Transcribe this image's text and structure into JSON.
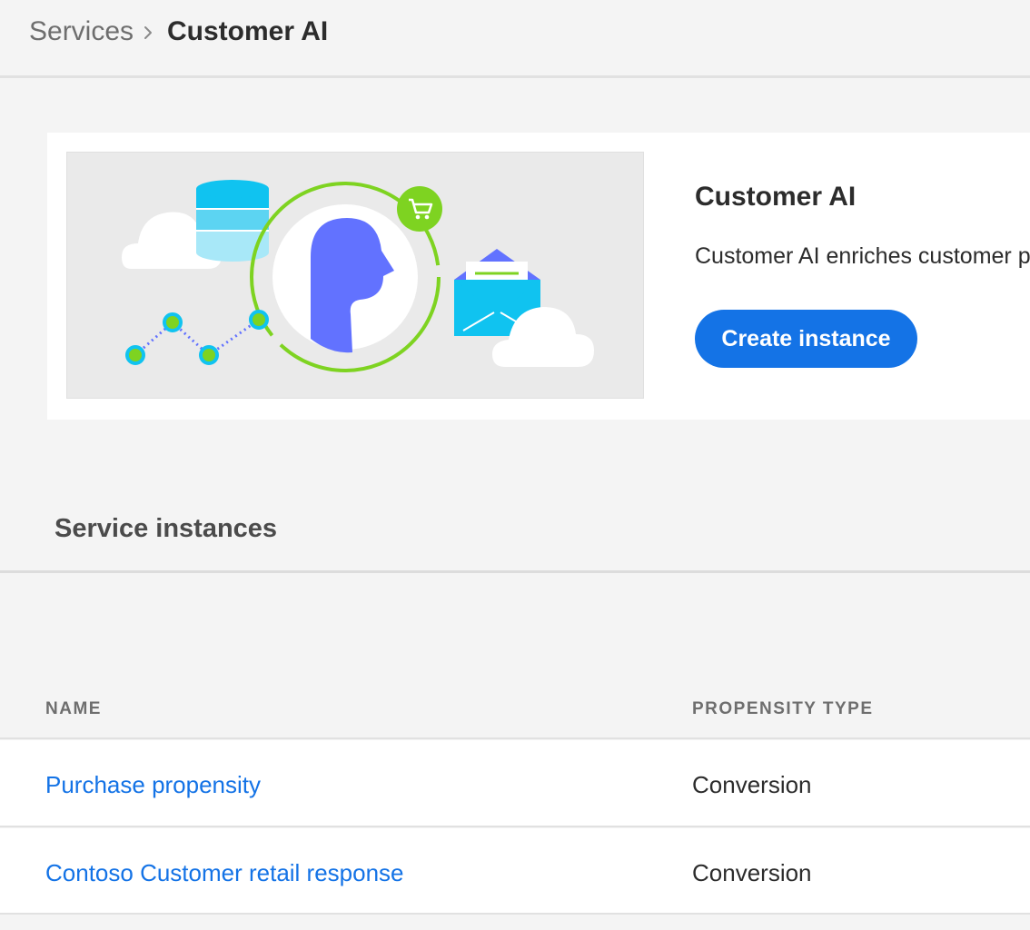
{
  "breadcrumb": {
    "parent": "Services",
    "current": "Customer AI"
  },
  "card": {
    "title": "Customer AI",
    "description": "Customer AI enriches customer p",
    "create_button": "Create instance"
  },
  "section": {
    "title": "Service instances"
  },
  "table": {
    "columns": [
      "NAME",
      "PROPENSITY TYPE"
    ],
    "rows": [
      {
        "name": "Purchase propensity",
        "propensity_type": "Conversion"
      },
      {
        "name": "Contoso Customer retail response",
        "propensity_type": "Conversion"
      }
    ]
  },
  "colors": {
    "accent": "#1473e6",
    "background": "#f4f4f4",
    "illustration_green": "#7ed321",
    "illustration_cyan": "#10c3f0",
    "illustration_purple": "#6272ff"
  },
  "icons": [
    "chevron-right-icon",
    "shopping-cart-icon",
    "database-icon",
    "envelope-icon",
    "cloud-icon",
    "person-icon"
  ]
}
